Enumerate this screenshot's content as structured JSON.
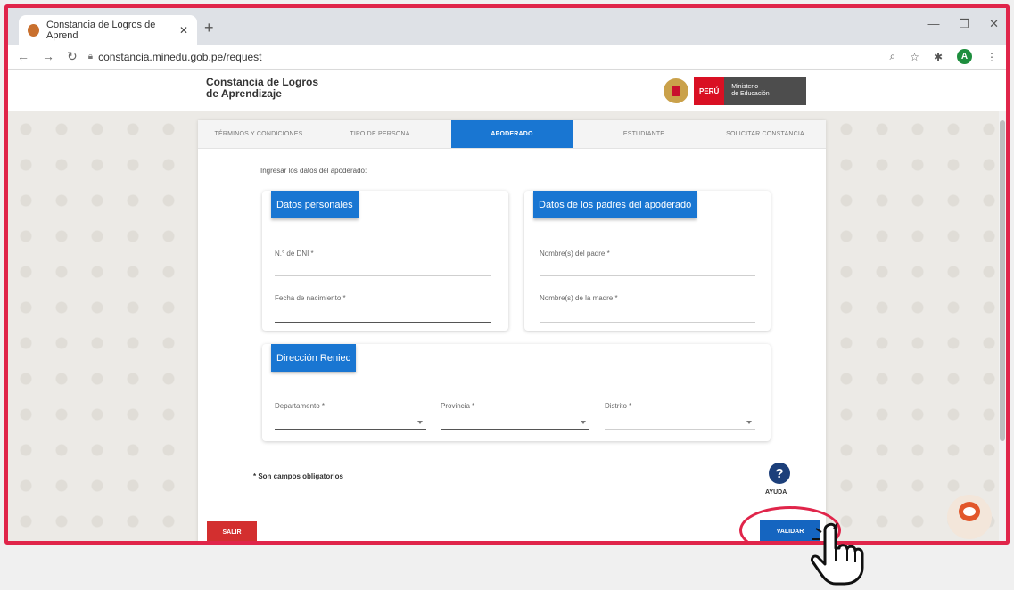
{
  "browser": {
    "tab_title": "Constancia de Logros de Aprend",
    "tab_close": "✕",
    "new_tab": "+",
    "url": "constancia.minedu.gob.pe/request",
    "avatar": "A"
  },
  "header": {
    "title_line1": "Constancia de Logros",
    "title_line2": "de Aprendizaje",
    "peru_label": "PERÚ",
    "ministry_line1": "Ministerio",
    "ministry_line2": "de Educación"
  },
  "steps": [
    "TÉRMINOS Y CONDICIONES",
    "TIPO DE PERSONA",
    "APODERADO",
    "ESTUDIANTE",
    "SOLICITAR CONSTANCIA"
  ],
  "form": {
    "intro": "Ingresar los datos del apoderado:",
    "personal": {
      "title": "Datos personales",
      "dni_label": "N.° de DNI *",
      "birth_label": "Fecha de nacimiento *"
    },
    "parents": {
      "title": "Datos de los padres del apoderado",
      "father_label": "Nombre(s) del padre *",
      "mother_label": "Nombre(s) de la madre *"
    },
    "address": {
      "title": "Dirección Reniec",
      "department_label": "Departamento *",
      "province_label": "Provincia *",
      "district_label": "Distrito *"
    },
    "required_note": "* Son campos obligatorios"
  },
  "actions": {
    "help_icon": "?",
    "help_label": "AYUDA",
    "exit_label": "SALIR",
    "validate_label": "VALIDAR"
  },
  "colors": {
    "accent": "#1976d2",
    "highlight": "#e0254a",
    "exit": "#d32f2f"
  }
}
